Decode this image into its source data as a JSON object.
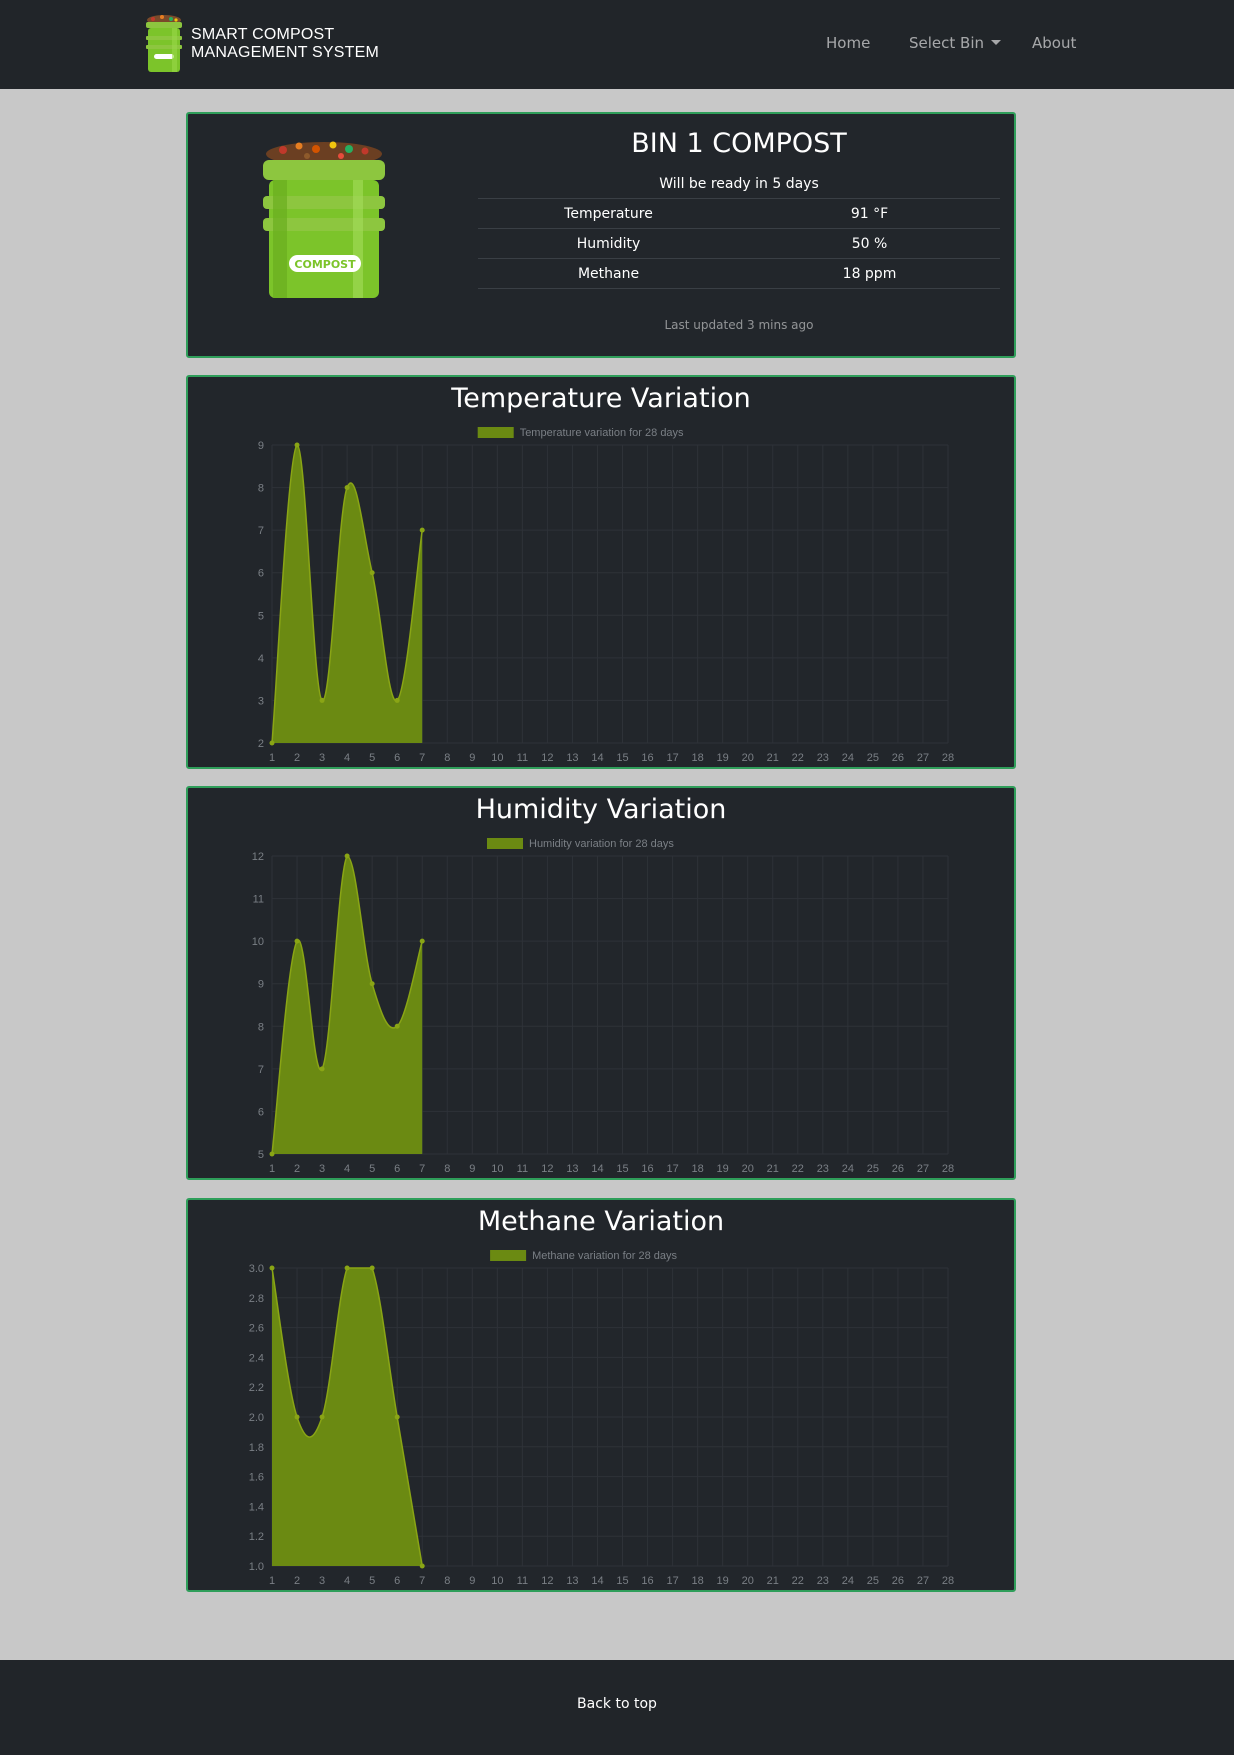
{
  "navbar": {
    "brand_line1": "SMART COMPOST",
    "brand_line2": "MANAGEMENT SYSTEM",
    "links": [
      {
        "label": "Home"
      },
      {
        "label": "Select Bin"
      },
      {
        "label": "About"
      }
    ]
  },
  "bin": {
    "title": "BIN 1 COMPOST",
    "ready_text": "Will be ready in 5 days",
    "image_label": "COMPOST",
    "readings": [
      {
        "label": "Temperature",
        "value": "91 °F"
      },
      {
        "label": "Humidity",
        "value": "50 %"
      },
      {
        "label": "Methane",
        "value": "18 ppm"
      }
    ],
    "last_updated": "Last updated 3 mins ago"
  },
  "colors": {
    "accent": "#6b8a12",
    "point": "#8aa515",
    "card_border": "#2f9e5a"
  },
  "chart_data": [
    {
      "type": "area",
      "title": "Temperature Variation",
      "legend": "Temperature variation for 28 days",
      "x": [
        "1",
        "2",
        "3",
        "4",
        "5",
        "6",
        "7",
        "8",
        "9",
        "10",
        "11",
        "12",
        "13",
        "14",
        "15",
        "16",
        "17",
        "18",
        "19",
        "20",
        "21",
        "22",
        "23",
        "24",
        "25",
        "26",
        "27",
        "28"
      ],
      "values": [
        2,
        9,
        3,
        8,
        6,
        3,
        7
      ],
      "ylim": [
        2,
        9
      ],
      "yticks": [
        "2",
        "3",
        "4",
        "5",
        "6",
        "7",
        "8",
        "9"
      ],
      "grid": true
    },
    {
      "type": "area",
      "title": "Humidity Variation",
      "legend": "Humidity variation for 28 days",
      "x": [
        "1",
        "2",
        "3",
        "4",
        "5",
        "6",
        "7",
        "8",
        "9",
        "10",
        "11",
        "12",
        "13",
        "14",
        "15",
        "16",
        "17",
        "18",
        "19",
        "20",
        "21",
        "22",
        "23",
        "24",
        "25",
        "26",
        "27",
        "28"
      ],
      "values": [
        5,
        10,
        7,
        12,
        9,
        8,
        10
      ],
      "ylim": [
        5,
        12
      ],
      "yticks": [
        "5",
        "6",
        "7",
        "8",
        "9",
        "10",
        "11",
        "12"
      ],
      "grid": true
    },
    {
      "type": "area",
      "title": "Methane Variation",
      "legend": "Methane variation for 28 days",
      "x": [
        "1",
        "2",
        "3",
        "4",
        "5",
        "6",
        "7",
        "8",
        "9",
        "10",
        "11",
        "12",
        "13",
        "14",
        "15",
        "16",
        "17",
        "18",
        "19",
        "20",
        "21",
        "22",
        "23",
        "24",
        "25",
        "26",
        "27",
        "28"
      ],
      "values": [
        3.0,
        2.0,
        2.0,
        3.0,
        3.0,
        2.0,
        1.0
      ],
      "ylim": [
        1.0,
        3.0
      ],
      "yticks": [
        "1.0",
        "1.2",
        "1.4",
        "1.6",
        "1.8",
        "2.0",
        "2.2",
        "2.4",
        "2.6",
        "2.8",
        "3.0"
      ],
      "grid": true
    }
  ],
  "footer": {
    "back_to_top": "Back to top"
  }
}
